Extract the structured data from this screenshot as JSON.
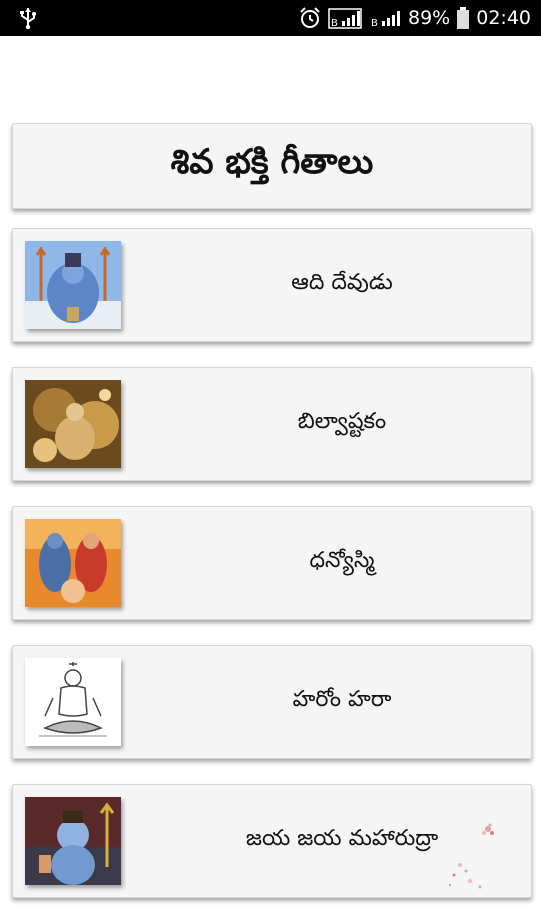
{
  "status_bar": {
    "battery": "89%",
    "time": "02:40",
    "icons": [
      "usb-icon",
      "alarm-icon",
      "signal-icon",
      "signal-icon",
      "battery-icon"
    ]
  },
  "header": {
    "title": "శివ భక్తి గీతాలు"
  },
  "items": [
    {
      "label": "ఆది దేవుడు",
      "thumb_icon": "shiva-image"
    },
    {
      "label": "బిల్వాష్టకం",
      "thumb_icon": "shiva-meditating-image"
    },
    {
      "label": "ధన్యోస్మి",
      "thumb_icon": "shiva-parvati-image"
    },
    {
      "label": "హరోం హరా",
      "thumb_icon": "shiva-sketch-image"
    },
    {
      "label": "జయ జయ మహారుద్రా",
      "thumb_icon": "shiva-trident-image"
    }
  ],
  "colors": {
    "status_bar": "#000000",
    "card_background": "#f5f5f5",
    "page_background": "#ffffff"
  }
}
